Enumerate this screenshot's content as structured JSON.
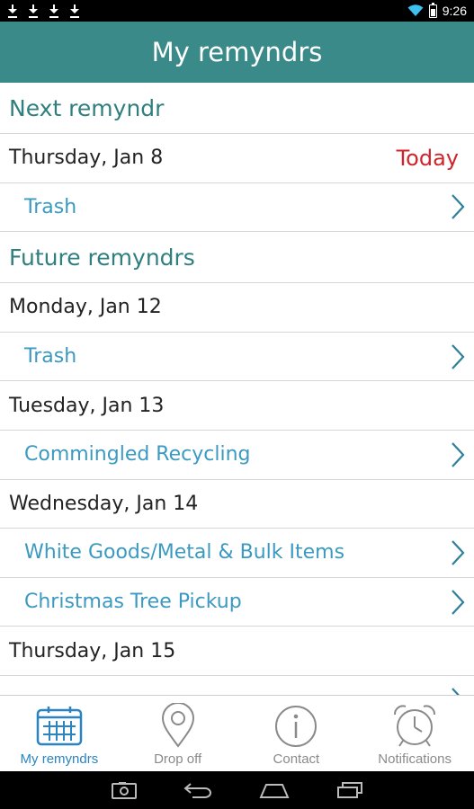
{
  "status_bar": {
    "time": "9:26",
    "icons": [
      "download-icon",
      "download-icon",
      "download-icon",
      "download-icon",
      "wifi-icon",
      "battery-icon"
    ]
  },
  "app_bar": {
    "title": "My remyndrs"
  },
  "next_section": {
    "header": "Next remyndr",
    "date": "Thursday, Jan 8",
    "badge": "Today",
    "items": [
      "Trash"
    ]
  },
  "future_section": {
    "header": "Future remyndrs",
    "groups": [
      {
        "date": "Monday, Jan 12",
        "items": [
          "Trash"
        ]
      },
      {
        "date": "Tuesday, Jan 13",
        "items": [
          "Commingled Recycling"
        ]
      },
      {
        "date": "Wednesday, Jan 14",
        "items": [
          "White Goods/Metal & Bulk Items",
          "Christmas Tree Pickup"
        ]
      },
      {
        "date": "Thursday, Jan 15",
        "items": [
          ""
        ]
      }
    ]
  },
  "tabs": [
    {
      "label": "My remyndrs",
      "icon": "calendar-icon",
      "active": true
    },
    {
      "label": "Drop off",
      "icon": "map-pin-icon",
      "active": false
    },
    {
      "label": "Contact",
      "icon": "info-icon",
      "active": false
    },
    {
      "label": "Notifications",
      "icon": "alarm-clock-icon",
      "active": false
    }
  ],
  "colors": {
    "app_bar": "#3a8a89",
    "section_header": "#2f7f7e",
    "item_text": "#3b9ac2",
    "today": "#d0242a",
    "active_tab": "#2a84c2"
  }
}
